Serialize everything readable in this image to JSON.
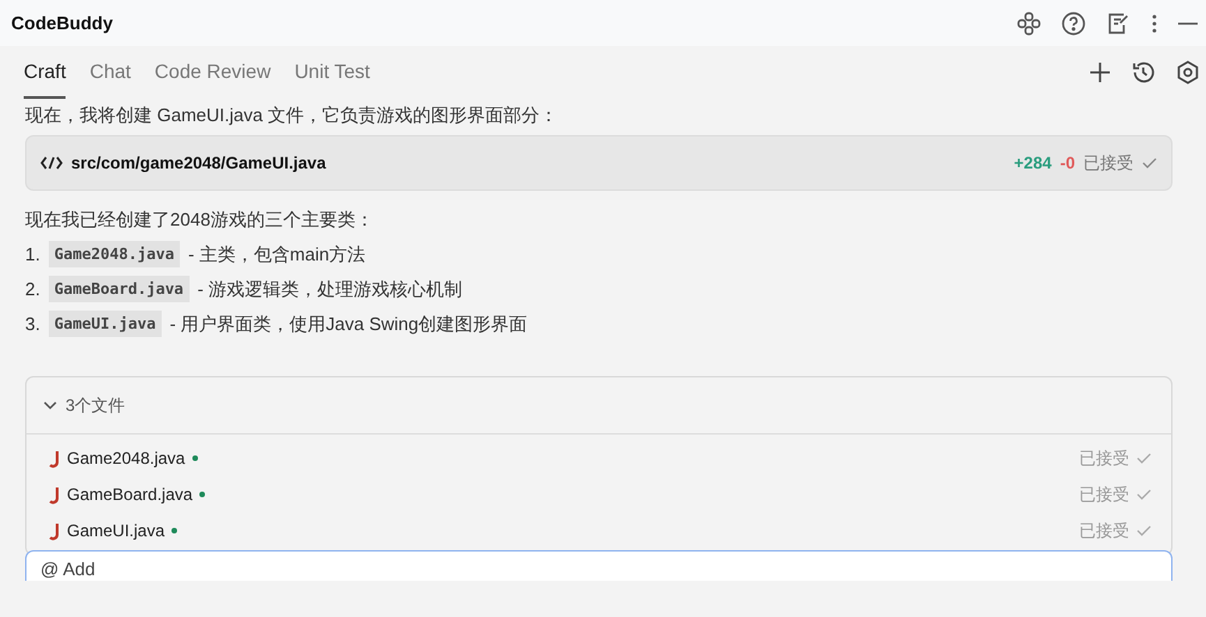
{
  "window": {
    "title": "CodeBuddy"
  },
  "tabs": [
    {
      "label": "Craft",
      "selected": true
    },
    {
      "label": "Chat",
      "selected": false
    },
    {
      "label": "Code Review",
      "selected": false
    },
    {
      "label": "Unit Test",
      "selected": false
    }
  ],
  "intro": "现在，我将创建 GameUI.java 文件，它负责游戏的图形界面部分：",
  "code_file": {
    "path": "src/com/game2048/GameUI.java",
    "added": "+284",
    "removed": "-0",
    "status": "已接受"
  },
  "summary": "现在我已经创建了2048游戏的三个主要类：",
  "classes": [
    {
      "number": "1.",
      "name": "Game2048.java",
      "description": "- 主类，包含main方法"
    },
    {
      "number": "2.",
      "name": "GameBoard.java",
      "description": "- 游戏逻辑类，处理游戏核心机制"
    },
    {
      "number": "3.",
      "name": "GameUI.java",
      "description": "- 用户界面类，使用Java Swing创建图形界面"
    }
  ],
  "files_panel": {
    "title": "3个文件",
    "expanded": true,
    "files": [
      {
        "name": "Game2048.java",
        "modified": true,
        "status": "已接受"
      },
      {
        "name": "GameBoard.java",
        "modified": true,
        "status": "已接受"
      },
      {
        "name": "GameUI.java",
        "modified": true,
        "status": "已接受"
      }
    ]
  },
  "input": {
    "placeholder": "@ Add"
  }
}
